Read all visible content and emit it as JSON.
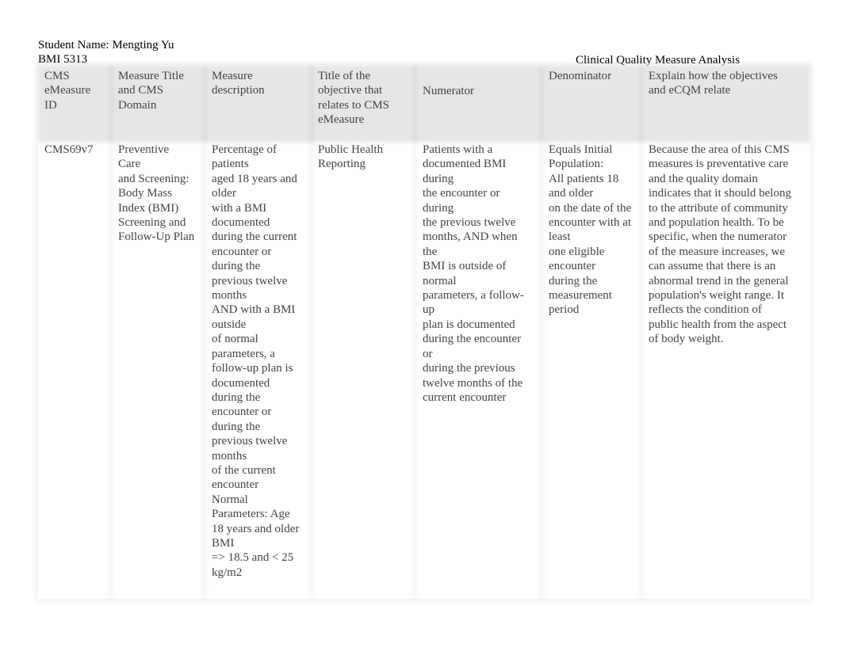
{
  "header": {
    "student": "Student Name: Mengting Yu",
    "course": "BMI 5313",
    "title": "Clinical Quality Measure Analysis"
  },
  "table": {
    "columns": [
      "CMS\neMeasure\nID",
      "Measure Title\nand CMS\nDomain",
      "Measure\ndescription",
      "Title of the\nobjective that\nrelates to CMS\neMeasure",
      "Numerator",
      "Denominator",
      "Explain how the objectives\nand eCQM relate"
    ],
    "row": [
      "CMS69v7",
      " Preventive\nCare\nand Screening:\nBody Mass\nIndex (BMI)\nScreening and\nFollow-Up Plan",
      "Percentage of\npatients\naged 18 years and\nolder\nwith a BMI\ndocumented\nduring the current\nencounter or\nduring the\nprevious twelve\nmonths\nAND with a BMI\noutside\nof normal\nparameters, a\nfollow-up plan is\ndocumented\nduring the\nencounter or\nduring the\nprevious twelve\nmonths\nof the current\nencounter\nNormal\nParameters: Age\n18 years and older\nBMI\n=> 18.5 and < 25\nkg/m2",
      " Public Health\nReporting",
      "Patients with a\ndocumented BMI\nduring\nthe encounter or\nduring\nthe previous twelve\nmonths, AND when\nthe\nBMI is outside of\nnormal\nparameters, a follow-\nup\nplan is documented\nduring the encounter\nor\nduring the previous\ntwelve months of the\ncurrent encounter",
      "Equals Initial\nPopulation:\nAll patients 18\nand older\non the date of the\nencounter with at\nleast\none eligible\nencounter\nduring the\nmeasurement\nperiod",
      "Because the area of this CMS\nmeasures is preventative care\nand the quality domain\nindicates that it should belong\nto the attribute of community\nand population health. To be\nspecific, when the numerator\nof the measure increases, we\ncan assume that there is an\nabnormal trend in the general\npopulation's weight range. It\nreflects the condition of\npublic health from the aspect\nof body weight."
    ]
  }
}
